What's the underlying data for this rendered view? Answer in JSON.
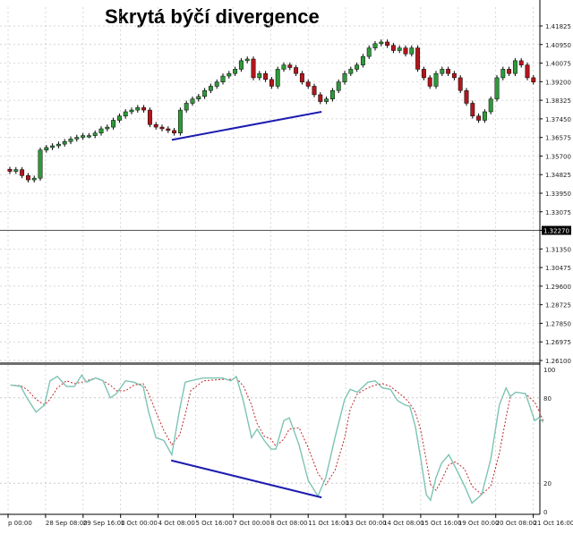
{
  "title": "Skrytá býčí divergence",
  "colors": {
    "bull": "#2f9a3a",
    "bear": "#b3161c",
    "outline": "#000000",
    "stoch_main": "#7cc4b4",
    "stoch_signal": "#c0282c",
    "divergence": "#1c1cb0",
    "grid": "#c8c8c8"
  },
  "chart_data": [
    {
      "type": "candlestick",
      "ylim": [
        1.261,
        1.41825
      ],
      "grid": true,
      "y_ticks": [
        "1.41825",
        "1.40950",
        "1.40075",
        "1.39200",
        "1.38325",
        "1.37450",
        "1.36575",
        "1.35700",
        "1.34825",
        "1.33950",
        "1.33075",
        "1.32270",
        "1.31350",
        "1.30475",
        "1.29600",
        "1.28725",
        "1.27850",
        "1.26975",
        "1.26100"
      ],
      "current_price": "1.32270",
      "closes": [
        1.3499,
        1.3507,
        1.3479,
        1.3459,
        1.3467,
        1.3599,
        1.3611,
        1.3619,
        1.3627,
        1.3639,
        1.3651,
        1.3659,
        1.3667,
        1.3667,
        1.3679,
        1.3699,
        1.3707,
        1.3739,
        1.3759,
        1.3779,
        1.3787,
        1.3799,
        1.3787,
        1.3719,
        1.3707,
        1.3699,
        1.3691,
        1.3679,
        1.3787,
        1.3819,
        1.3839,
        1.3851,
        1.3879,
        1.3899,
        1.3919,
        1.3947,
        1.3959,
        1.3979,
        1.4019,
        1.4027,
        1.3939,
        1.3959,
        1.3931,
        1.3899,
        1.3979,
        1.3999,
        1.3987,
        1.3959,
        1.3919,
        1.3899,
        1.3859,
        1.3827,
        1.3839,
        1.3879,
        1.3919,
        1.3959,
        1.3979,
        1.3999,
        1.4039,
        1.4079,
        1.4099,
        1.4107,
        1.4091,
        1.4067,
        1.4079,
        1.4051,
        1.4079,
        1.3979,
        1.3939,
        1.3899,
        1.3959,
        1.3979,
        1.3959,
        1.3939,
        1.3879,
        1.3819,
        1.3759,
        1.3739,
        1.3779,
        1.3839,
        1.3939,
        1.3979,
        1.3959,
        1.4019,
        1.3999,
        1.3939,
        1.3919
      ],
      "divergence_line": {
        "from": {
          "bar": 26.6,
          "price": 1.3647
        },
        "to": {
          "bar": 51.2,
          "price": 1.3779
        }
      }
    },
    {
      "type": "line",
      "ylim": [
        0,
        100
      ],
      "y_ticks": [
        "100",
        "80",
        "20",
        "0"
      ],
      "levels": [
        80,
        20
      ],
      "x_bars": [
        0.1,
        1.8,
        2.8,
        4.3,
        5.7,
        6.6,
        7.8,
        9.3,
        10.6,
        11.8,
        12.6,
        14.1,
        15.3,
        16.5,
        17.5,
        19,
        20.4,
        21.9,
        22.8,
        24,
        25.3,
        26.6,
        27.9,
        28.8,
        29.7,
        31.8,
        34.9,
        36.3,
        37.2,
        38.4,
        39.7,
        40.6,
        41.8,
        42.9,
        43.7,
        45,
        45.9,
        47.5,
        49,
        50.6,
        51.9,
        53.4,
        55,
        55.9,
        57.1,
        58.8,
        60,
        61.2,
        62.5,
        63.7,
        64.9,
        65.7,
        66.6,
        67.5,
        68.4,
        69.1,
        70,
        70.9,
        72.1,
        73.2,
        74.7,
        75.9,
        77.5,
        79,
        80.4,
        81.5,
        82.2,
        83.1,
        84.7,
        86.2,
        86.9,
        87.6
      ],
      "series": [
        {
          "values": [
            89,
            88,
            80,
            70,
            75,
            92,
            95,
            88,
            88,
            96,
            91,
            94,
            92,
            80,
            83,
            92,
            91,
            88,
            70,
            52,
            50,
            40,
            72,
            91,
            92,
            94,
            94,
            92,
            95,
            77,
            52,
            58,
            50,
            44,
            44,
            64,
            66,
            47,
            22,
            11,
            24,
            52,
            79,
            86,
            84,
            91,
            92,
            87,
            86,
            78,
            75,
            74,
            60,
            37,
            12,
            8,
            24,
            34,
            40,
            31,
            18,
            6,
            12,
            37,
            75,
            87,
            81,
            84,
            83,
            64,
            66,
            63
          ]
        },
        {
          "values": [
            89,
            88.5,
            86,
            79,
            75,
            79,
            87,
            92,
            90,
            91,
            92,
            94,
            92,
            89,
            85,
            85,
            89,
            90,
            83,
            70,
            57,
            47,
            54,
            68,
            85,
            92,
            93,
            93,
            94,
            88,
            75,
            62,
            53,
            51,
            46,
            51,
            58,
            59,
            45,
            27,
            19,
            29,
            52,
            72,
            83,
            87,
            89,
            90,
            88,
            84,
            80,
            76,
            70,
            57,
            36,
            19,
            15,
            22,
            33,
            35,
            30,
            18,
            12,
            18,
            41,
            66,
            81,
            84,
            83,
            77,
            71,
            64
          ]
        }
      ],
      "divergence_line": {
        "from": {
          "bar": 26.5,
          "value": 36
        },
        "to": {
          "bar": 51.2,
          "value": 10
        }
      }
    }
  ],
  "x_ticks": [
    "p 00:00",
    "28 Sep 08:00",
    "29 Sep 16:00",
    "1 Oct 00:00",
    "4 Oct 08:00",
    "5 Oct 16:00",
    "7 Oct 00:00",
    "8 Oct 08:00",
    "11 Oct 16:00",
    "13 Oct 00:00",
    "14 Oct 08:00",
    "15 Oct 16:00",
    "19 Oct 00:00",
    "20 Oct 08:00",
    "21 Oct 16:00"
  ]
}
